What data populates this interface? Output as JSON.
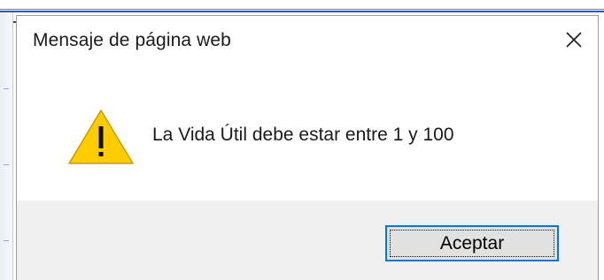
{
  "dialog": {
    "title": "Mensaje de página web",
    "message": "La Vida Útil debe estar entre 1 y 100",
    "icon": "warning-icon",
    "close_icon": "close-icon",
    "ok_label": "Aceptar"
  },
  "colors": {
    "accent": "#0078d7",
    "warning_fill": "#ffcc00",
    "footer_bg": "#f0f0f0",
    "button_bg": "#e1e1e1"
  }
}
